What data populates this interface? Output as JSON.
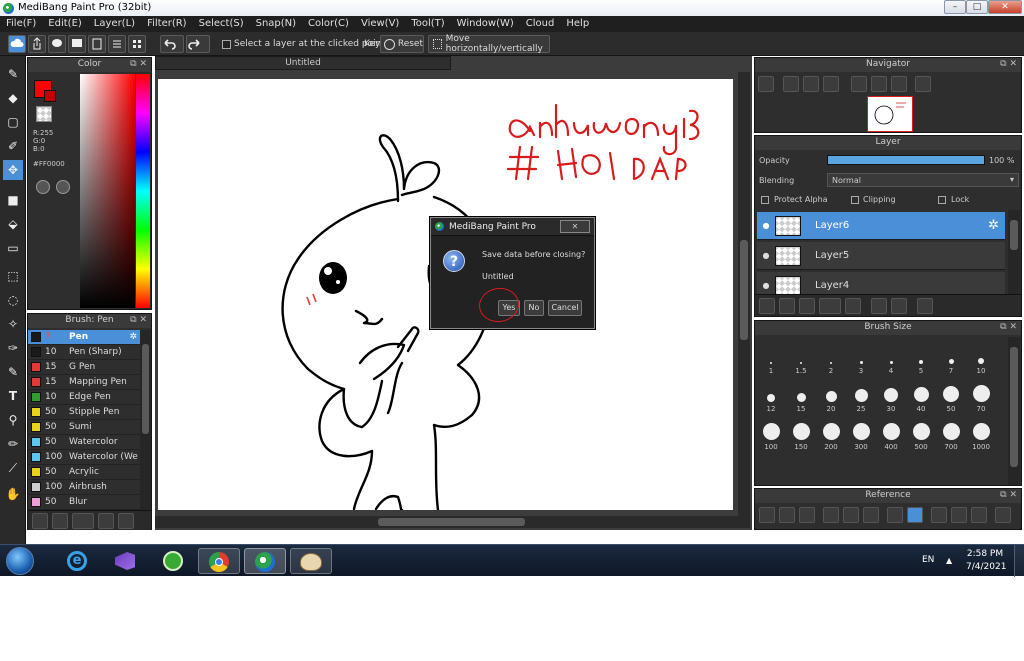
{
  "window": {
    "title": "MediBang Paint Pro (32bit)",
    "minimize": "–",
    "maximize": "□",
    "close": "✕"
  },
  "menu": [
    "File(F)",
    "Edit(E)",
    "Layer(L)",
    "Filter(R)",
    "Select(S)",
    "Snap(N)",
    "Color(C)",
    "View(V)",
    "Tool(T)",
    "Window(W)",
    "Cloud",
    "Help"
  ],
  "toolbar": {
    "select_layer_label": "Select a layer at the clicked point",
    "key_label": "Key",
    "reset_label": "Reset",
    "move_label": "Move horizontally/vertically"
  },
  "color_panel": {
    "title": "Color",
    "r": "R:255",
    "g": "G:0",
    "b": "B:0",
    "hex": "#FF0000",
    "primary": "#FF0000"
  },
  "brush_panel": {
    "title": "Brush: Pen",
    "items": [
      {
        "size": "7",
        "name": "Pen",
        "color": "#1a1a1a"
      },
      {
        "size": "10",
        "name": "Pen (Sharp)",
        "color": "#1a1a1a"
      },
      {
        "size": "15",
        "name": "G Pen",
        "color": "#e53935"
      },
      {
        "size": "15",
        "name": "Mapping Pen",
        "color": "#e53935"
      },
      {
        "size": "10",
        "name": "Edge Pen",
        "color": "#2e9e2e"
      },
      {
        "size": "50",
        "name": "Stipple Pen",
        "color": "#e8d21a"
      },
      {
        "size": "50",
        "name": "Sumi",
        "color": "#e8d21a"
      },
      {
        "size": "50",
        "name": "Watercolor",
        "color": "#5cc8f0"
      },
      {
        "size": "100",
        "name": "Watercolor (We",
        "color": "#5cc8f0"
      },
      {
        "size": "50",
        "name": "Acrylic",
        "color": "#e8d21a"
      },
      {
        "size": "100",
        "name": "Airbrush",
        "color": "#cfcfcf"
      },
      {
        "size": "50",
        "name": "Blur",
        "color": "#f0a0d8"
      }
    ]
  },
  "canvas": {
    "tab_title": "Untitled",
    "handwriting_line1": "anhvuong198",
    "handwriting_line2": "# HOI DAP"
  },
  "dialog": {
    "title": "MediBang Paint Pro",
    "question": "Save data before closing?",
    "filename": "Untitled",
    "yes": "Yes",
    "no": "No",
    "cancel": "Cancel"
  },
  "navigator": {
    "title": "Navigator"
  },
  "layer_panel": {
    "title": "Layer",
    "opacity_label": "Opacity",
    "opacity_value": "100 %",
    "opacity_fraction": 1.0,
    "blending_label": "Blending",
    "blending_value": "Normal",
    "protect_alpha": "Protect Alpha",
    "clipping": "Clipping",
    "lock": "Lock",
    "layers": [
      {
        "name": "Layer6"
      },
      {
        "name": "Layer5"
      },
      {
        "name": "Layer4"
      }
    ]
  },
  "brush_size_panel": {
    "title": "Brush Size",
    "sizes": [
      "1",
      "1.5",
      "2",
      "3",
      "4",
      "5",
      "7",
      "10",
      "12",
      "15",
      "20",
      "25",
      "30",
      "40",
      "50",
      "70",
      "100",
      "150",
      "200",
      "300",
      "400",
      "500",
      "700",
      "1000"
    ]
  },
  "reference_panel": {
    "title": "Reference"
  },
  "taskbar": {
    "lang": "EN",
    "time": "2:58 PM",
    "date": "7/4/2021"
  }
}
